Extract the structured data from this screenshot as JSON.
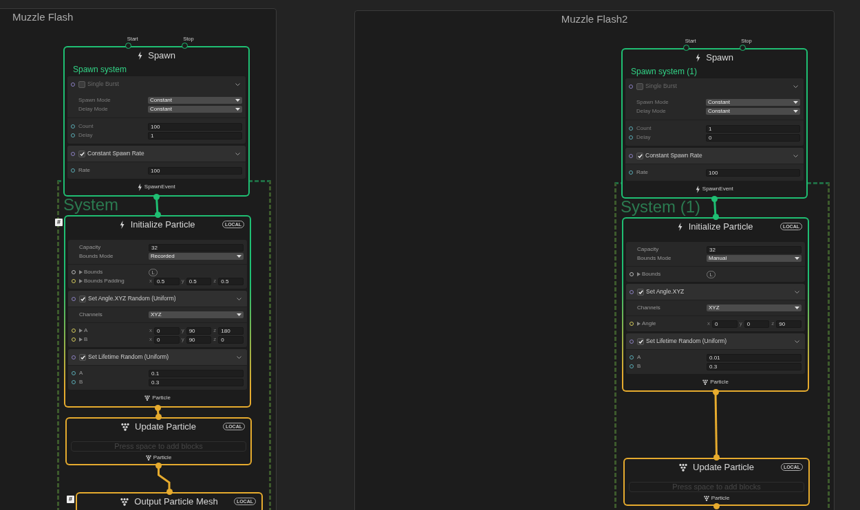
{
  "graphs": [
    {
      "title": "Muzzle Flash",
      "system_title": "System",
      "nodes": [
        {
          "kind": "spawn",
          "title": "Spawn",
          "subtitle": "Spawn system",
          "inputs": [
            "Start",
            "Stop"
          ],
          "output": "SpawnEvent",
          "blocks": [
            {
              "title": "Single Burst",
              "enabled": false,
              "sections": [
                [
                  {
                    "kind": "dropdown",
                    "label": "Spawn Mode",
                    "value": "Constant",
                    "port": false
                  },
                  {
                    "kind": "dropdown",
                    "label": "Delay Mode",
                    "value": "Constant",
                    "port": false
                  }
                ],
                [
                  {
                    "kind": "field",
                    "label": "Count",
                    "value": "100",
                    "port": true
                  },
                  {
                    "kind": "field",
                    "label": "Delay",
                    "value": "1",
                    "port": true
                  }
                ]
              ]
            },
            {
              "title": "Constant Spawn Rate",
              "enabled": true,
              "sections": [
                [
                  {
                    "kind": "field",
                    "label": "Rate",
                    "value": "100",
                    "port": true
                  }
                ]
              ]
            }
          ]
        },
        {
          "kind": "initialize",
          "title": "Initialize Particle",
          "badge": "LOCAL",
          "tag": "#",
          "output": "Particle",
          "blocks": [
            {
              "sections": [
                [
                  {
                    "kind": "field",
                    "label": "Capacity",
                    "value": "32",
                    "port": false
                  },
                  {
                    "kind": "dropdown",
                    "label": "Bounds Mode",
                    "value": "Recorded",
                    "port": false
                  }
                ],
                [
                  {
                    "kind": "space",
                    "label": "Bounds",
                    "space": "L",
                    "port": true
                  },
                  {
                    "kind": "vector",
                    "label": "Bounds Padding",
                    "axes": [
                      "x",
                      "y",
                      "z"
                    ],
                    "values": [
                      "0.5",
                      "0.5",
                      "0.5"
                    ],
                    "port": true
                  }
                ]
              ]
            },
            {
              "title": "Set Angle.XYZ Random (Uniform)",
              "enabled": true,
              "sections": [
                [
                  {
                    "kind": "dropdown",
                    "label": "Channels",
                    "value": "XYZ",
                    "port": false
                  }
                ],
                [
                  {
                    "kind": "vector",
                    "label": "A",
                    "axes": [
                      "x",
                      "y",
                      "z"
                    ],
                    "values": [
                      "0",
                      "90",
                      "180"
                    ],
                    "port": true
                  },
                  {
                    "kind": "vector",
                    "label": "B",
                    "axes": [
                      "x",
                      "y",
                      "z"
                    ],
                    "values": [
                      "0",
                      "90",
                      "0"
                    ],
                    "port": true
                  }
                ]
              ]
            },
            {
              "title": "Set Lifetime Random (Uniform)",
              "enabled": true,
              "sections": [
                [
                  {
                    "kind": "field",
                    "label": "A",
                    "value": "0.1",
                    "port": true
                  },
                  {
                    "kind": "field",
                    "label": "B",
                    "value": "0.3",
                    "port": true
                  }
                ]
              ]
            }
          ]
        },
        {
          "kind": "update",
          "title": "Update Particle",
          "badge": "LOCAL",
          "placeholder": "Press space to add blocks",
          "output": "Particle"
        },
        {
          "kind": "output",
          "title": "Output Particle Mesh",
          "badge": "LOCAL",
          "tag": "#"
        }
      ]
    },
    {
      "title": "Muzzle Flash2",
      "system_title": "System (1)",
      "nodes": [
        {
          "kind": "spawn",
          "title": "Spawn",
          "subtitle": "Spawn system (1)",
          "inputs": [
            "Start",
            "Stop"
          ],
          "output": "SpawnEvent",
          "blocks": [
            {
              "title": "Single Burst",
              "enabled": false,
              "sections": [
                [
                  {
                    "kind": "dropdown",
                    "label": "Spawn Mode",
                    "value": "Constant",
                    "port": false
                  },
                  {
                    "kind": "dropdown",
                    "label": "Delay Mode",
                    "value": "Constant",
                    "port": false
                  }
                ],
                [
                  {
                    "kind": "field",
                    "label": "Count",
                    "value": "1",
                    "port": true
                  },
                  {
                    "kind": "field",
                    "label": "Delay",
                    "value": "0",
                    "port": true
                  }
                ]
              ]
            },
            {
              "title": "Constant Spawn Rate",
              "enabled": true,
              "sections": [
                [
                  {
                    "kind": "field",
                    "label": "Rate",
                    "value": "100",
                    "port": true
                  }
                ]
              ]
            }
          ]
        },
        {
          "kind": "initialize",
          "title": "Initialize Particle",
          "badge": "LOCAL",
          "output": "Particle",
          "blocks": [
            {
              "sections": [
                [
                  {
                    "kind": "field",
                    "label": "Capacity",
                    "value": "32",
                    "port": false
                  },
                  {
                    "kind": "dropdown",
                    "label": "Bounds Mode",
                    "value": "Manual",
                    "port": false
                  }
                ],
                [
                  {
                    "kind": "space",
                    "label": "Bounds",
                    "space": "L",
                    "port": true
                  }
                ]
              ]
            },
            {
              "title": "Set Angle.XYZ",
              "enabled": true,
              "sections": [
                [
                  {
                    "kind": "dropdown",
                    "label": "Channels",
                    "value": "XYZ",
                    "port": false
                  }
                ],
                [
                  {
                    "kind": "vector",
                    "label": "Angle",
                    "axes": [
                      "x",
                      "y",
                      "z"
                    ],
                    "values": [
                      "0",
                      "0",
                      "90"
                    ],
                    "port": true
                  }
                ]
              ]
            },
            {
              "title": "Set Lifetime Random (Uniform)",
              "enabled": true,
              "sections": [
                [
                  {
                    "kind": "field",
                    "label": "A",
                    "value": "0.01",
                    "port": true
                  },
                  {
                    "kind": "field",
                    "label": "B",
                    "value": "0.3",
                    "port": true
                  }
                ]
              ]
            }
          ]
        },
        {
          "kind": "update",
          "title": "Update Particle",
          "badge": "LOCAL",
          "placeholder": "Press space to add blocks",
          "output": "Particle"
        }
      ]
    }
  ]
}
